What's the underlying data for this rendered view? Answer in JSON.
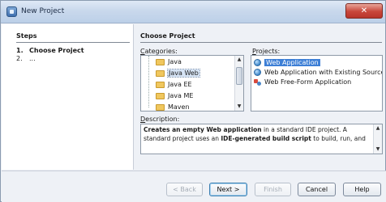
{
  "window": {
    "title": "New Project",
    "close_glyph": "✕"
  },
  "steps": {
    "title": "Steps",
    "items": [
      {
        "number": "1.",
        "label": "Choose Project"
      },
      {
        "number": "2.",
        "label": "..."
      }
    ]
  },
  "main": {
    "title": "Choose Project",
    "categories_label": "Categories:",
    "categories_mnemonic": "C",
    "categories_rest": "ategories:",
    "categories": [
      {
        "label": "Java",
        "selected": false
      },
      {
        "label": "Java Web",
        "selected": true
      },
      {
        "label": "Java EE",
        "selected": false
      },
      {
        "label": "Java ME",
        "selected": false
      },
      {
        "label": "Maven",
        "selected": false
      }
    ],
    "projects_label": "Projects:",
    "projects_mnemonic": "P",
    "projects_rest": "rojects:",
    "projects": [
      {
        "label": "Web Application",
        "icon": "globe-icon",
        "selected": true
      },
      {
        "label": "Web Application with Existing Sources",
        "icon": "globe-icon",
        "selected": false
      },
      {
        "label": "Web Free-Form Application",
        "icon": "freeform-icon",
        "selected": false
      }
    ],
    "description_label": "Description:",
    "description_mnemonic": "D",
    "description_rest": "escription:",
    "description": {
      "bold1": "Creates an empty Web application",
      "text1": " in a standard IDE project. A standard project uses an ",
      "bold2": "IDE-generated build script",
      "text2": " to build, run, and"
    }
  },
  "buttons": {
    "back": "< Back",
    "next": "Next >",
    "finish": "Finish",
    "cancel": "Cancel",
    "help": "Help"
  },
  "colors": {
    "selection": "#3d7fd6",
    "titlebar": "#c9d8ec",
    "close": "#c8463a"
  }
}
